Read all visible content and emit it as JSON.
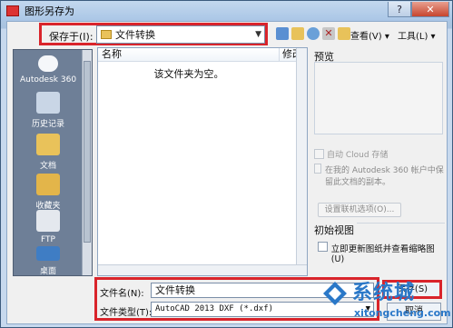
{
  "window": {
    "title": "图形另存为"
  },
  "toolbar": {
    "save_in_label": "保存于(I):",
    "path_value": "文件转换",
    "view_menu": "查看(V)",
    "tools_menu": "工具(L)"
  },
  "sidebar": {
    "items": [
      {
        "label": "Autodesk 360",
        "icon": "cloud-icon"
      },
      {
        "label": "历史记录",
        "icon": "history-icon"
      },
      {
        "label": "文档",
        "icon": "documents-icon"
      },
      {
        "label": "收藏夹",
        "icon": "favorites-icon"
      },
      {
        "label": "FTP",
        "icon": "ftp-icon"
      },
      {
        "label": "桌面",
        "icon": "desktop-icon"
      }
    ]
  },
  "file_list": {
    "columns": [
      "名称",
      "修改"
    ],
    "empty_message": "该文件夹为空。"
  },
  "preview": {
    "label": "预览",
    "cloud_save_label": "自动 Cloud 存储",
    "cloud_save_option": "在我的 Autodesk 360 帐户中保留此文档的副本。",
    "online_options_button": "设置联机选项(O)...",
    "initial_view_label": "初始视图",
    "initial_view_option": "立即更新图纸并查看缩略图(U)"
  },
  "bottom": {
    "filename_label": "文件名(N):",
    "filename_value": "文件转换",
    "filetype_label": "文件类型(T):",
    "filetype_value": "AutoCAD 2013 DXF (*.dxf)",
    "save_button": "保存(S)",
    "cancel_button": "取消"
  },
  "watermark": {
    "brand": "系统城",
    "url": "xitongcheng.com"
  },
  "colors": {
    "highlight": "#d9242b",
    "accent": "#2a78c8"
  }
}
